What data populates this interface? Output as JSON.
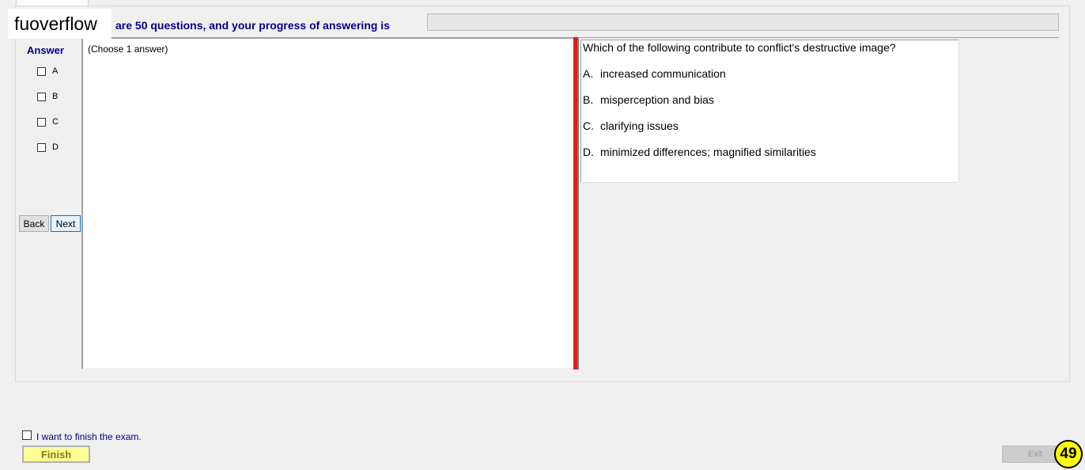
{
  "watermark": "fuoverflow",
  "header": {
    "progress_text": "are 50 questions, and your progress of answering is",
    "progress_fraction": 0
  },
  "answer_panel": {
    "heading": "Answer",
    "options": [
      "A",
      "B",
      "C",
      "D"
    ],
    "back_label": "Back",
    "next_label": "Next"
  },
  "content": {
    "instruction": "(Choose 1 answer)",
    "question": "Which of the following contribute to conflict's destructive image?",
    "choices": [
      {
        "letter": "A.",
        "text": "increased communication"
      },
      {
        "letter": "B.",
        "text": "misperception and bias"
      },
      {
        "letter": "C.",
        "text": "clarifying issues"
      },
      {
        "letter": "D.",
        "text": "minimized differences; magnified similarities"
      }
    ]
  },
  "footer": {
    "finish_checkbox_label": "I want to finish the exam.",
    "finish_label": "Finish",
    "exit_label": "Exit",
    "page_number": "49"
  },
  "colors": {
    "accent_text": "#00008b",
    "divider": "#e01b1b",
    "finish_bg": "#ffff99",
    "badge_bg": "#ffff00"
  }
}
